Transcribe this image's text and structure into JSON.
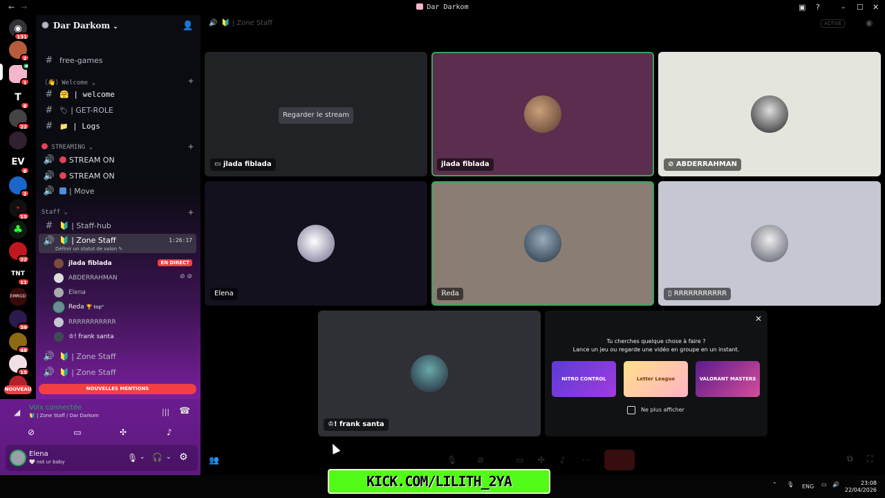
{
  "window": {
    "title": "Dar Darkom"
  },
  "rail": {
    "home_badge": "131",
    "servers": [
      {
        "name": "server-1",
        "badge": "2"
      },
      {
        "name": "server-2",
        "badge": "1"
      },
      {
        "name": "server-3",
        "badge": "8"
      },
      {
        "name": "server-4",
        "badge": "22"
      },
      {
        "name": "server-5",
        "badge": ""
      },
      {
        "name": "server-6",
        "badge": "8"
      },
      {
        "name": "server-7",
        "badge": "2"
      },
      {
        "name": "server-8",
        "badge": "15"
      },
      {
        "name": "server-9",
        "badge": ""
      },
      {
        "name": "server-10",
        "badge": "22"
      },
      {
        "name": "server-11",
        "badge": "11"
      },
      {
        "name": "server-12",
        "badge": ""
      },
      {
        "name": "server-13",
        "badge": "39"
      },
      {
        "name": "server-14",
        "badge": "48"
      },
      {
        "name": "server-15",
        "badge": "15"
      }
    ],
    "nouveau": "NOUVEAU"
  },
  "sidebar": {
    "server_name": "Dar Darkom",
    "channels_top": [
      {
        "label": "free-games"
      }
    ],
    "cat_welcome": "〔👋〕Welcome",
    "welcome": [
      {
        "label": "| welcome"
      },
      {
        "label": "| GET-ROLE"
      },
      {
        "label": "| Logs"
      }
    ],
    "cat_streaming": "STREAMING",
    "streaming": [
      {
        "label": "STREAM ON"
      },
      {
        "label": "STREAM ON"
      },
      {
        "label": "| Move"
      }
    ],
    "cat_staff": "Staff",
    "staff_hub": "| Staff-hub",
    "zone_staff": {
      "label": "| Zone Staff",
      "timer": "1:26:17",
      "status": "Définir un statut de salon"
    },
    "users": [
      {
        "name": "jlada fiblada",
        "tag": "EN DIRECT"
      },
      {
        "name": "ABDERRAHMAN",
        "tag": ""
      },
      {
        "name": "Elena",
        "tag": ""
      },
      {
        "name": "Reda",
        "tag": "🏆 top\""
      },
      {
        "name": "RRRRRRRRRRR",
        "tag": ""
      },
      {
        "name": "♔! frank santa",
        "tag": ""
      }
    ],
    "zone_staff_2": "| Zone Staff",
    "zone_staff_3": "| Zone Staff",
    "mentions": "NOUVELLES MENTIONS"
  },
  "voice": {
    "status": "Voix connectée",
    "location": "| Zone Staff / Dar Darkom"
  },
  "user": {
    "name": "Elena",
    "status": "not ur baby"
  },
  "main": {
    "channel": "| Zone Staff",
    "badge": "ACTIVÉ",
    "watch_stream": "Regarder le stream",
    "tiles": [
      {
        "name": "jlada fiblada",
        "bg": "#202226"
      },
      {
        "name": "jlada fiblada",
        "bg": "#5b2d4f"
      },
      {
        "name": "ABDERRAHMAN",
        "bg": "#e4e5dc"
      },
      {
        "name": "Elena",
        "bg": "#12111d"
      },
      {
        "name": "Reda",
        "bg": "#8a7d73"
      },
      {
        "name": "RRRRRRRRRRR",
        "bg": "#c5c8d3"
      },
      {
        "name": "♔! frank santa",
        "bg": "#2e3035"
      }
    ]
  },
  "activity": {
    "line1": "Tu cherches quelque chose à faire ?",
    "line2": "Lance un jeu ou regarde une vidéo en groupe en un instant.",
    "games": [
      {
        "name": "NITRO CONTROL"
      },
      {
        "name": "Letter League"
      },
      {
        "name": "VALORANT MASTERS"
      }
    ],
    "checkbox_label": "Ne plus afficher"
  },
  "overlay": {
    "kick_text": "KICK.COM/LILITH_2YA"
  },
  "taskbar": {
    "lang": "ENG",
    "time": "23:08",
    "date": "22/04/2026"
  }
}
